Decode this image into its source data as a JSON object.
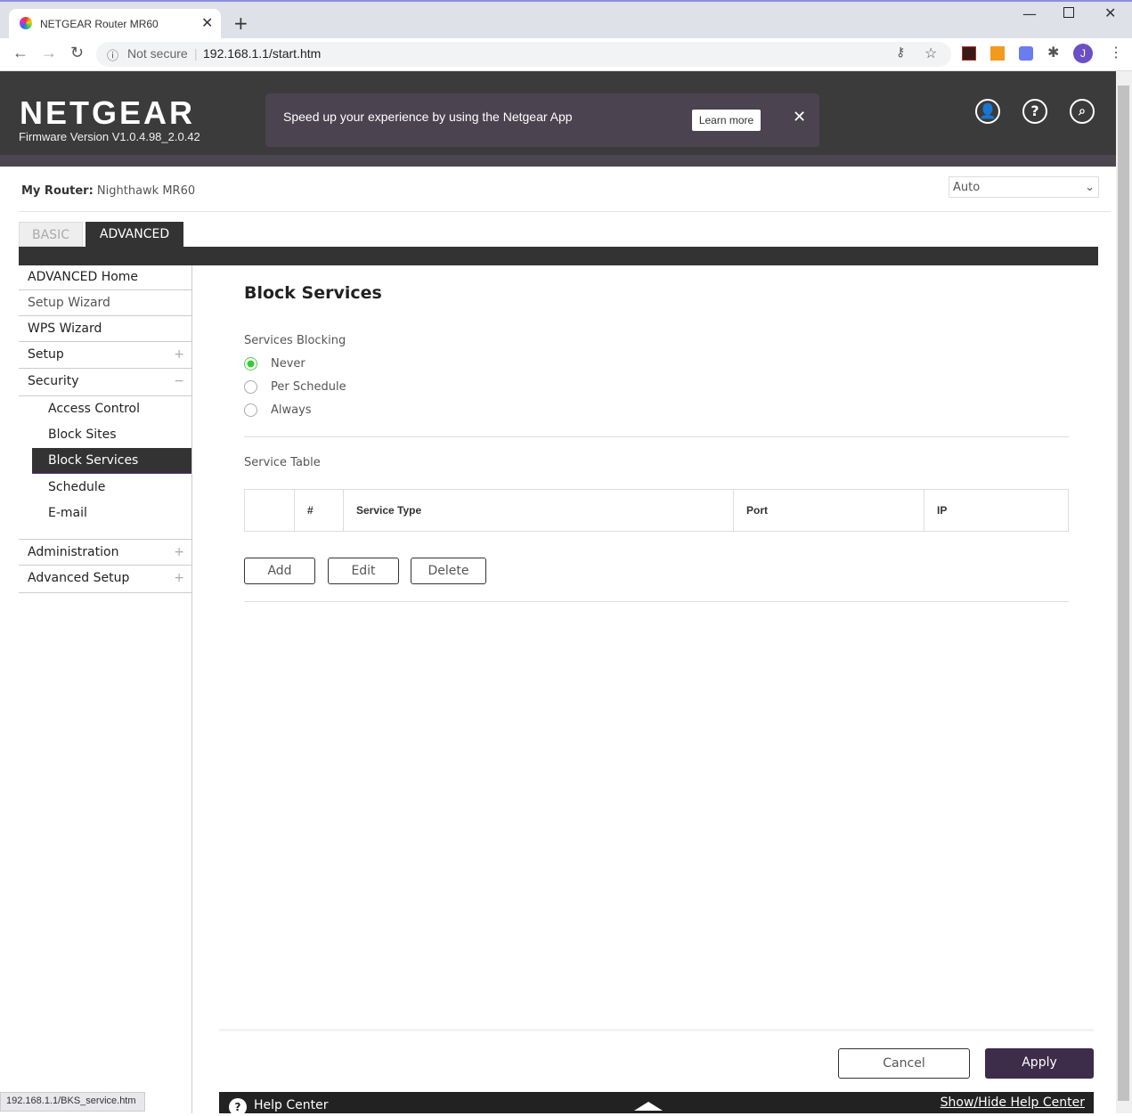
{
  "browser": {
    "tab_title": "NETGEAR Router MR60",
    "security": "Not secure",
    "url": "192.168.1.1/start.htm",
    "profile_initial": "J",
    "status_url": "192.168.1.1/BKS_service.htm"
  },
  "header": {
    "logo": "NETGEAR",
    "firmware": "Firmware Version V1.0.4.98_2.0.42",
    "banner_text": "Speed up your experience by using the Netgear App",
    "learn_more": "Learn more"
  },
  "router": {
    "label": "My Router:",
    "name": "Nighthawk MR60",
    "language": "Auto"
  },
  "tabs": [
    "BASIC",
    "ADVANCED"
  ],
  "sidebar": {
    "items": [
      "ADVANCED Home",
      "Setup Wizard",
      "WPS Wizard",
      "Setup",
      "Security",
      "Administration",
      "Advanced Setup"
    ],
    "security_sub": [
      "Access Control",
      "Block Sites",
      "Block Services",
      "Schedule",
      "E-mail"
    ]
  },
  "main": {
    "title": "Block Services",
    "blocking_label": "Services Blocking",
    "options": [
      "Never",
      "Per Schedule",
      "Always"
    ],
    "table_label": "Service Table",
    "columns": [
      "#",
      "Service Type",
      "Port",
      "IP"
    ],
    "buttons": [
      "Add",
      "Edit",
      "Delete"
    ]
  },
  "footer": {
    "cancel": "Cancel",
    "apply": "Apply",
    "help_center": "Help Center",
    "show_hide": "Show/Hide Help Center"
  }
}
